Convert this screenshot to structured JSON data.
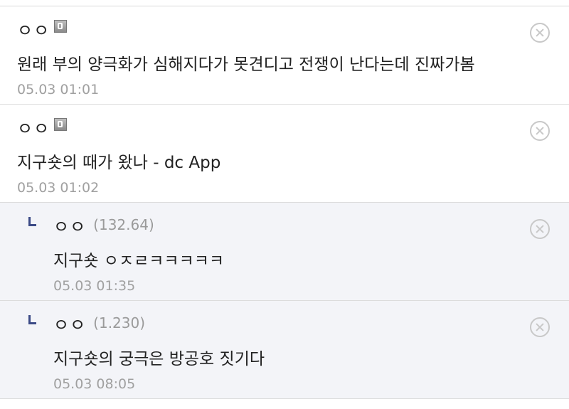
{
  "comments": [
    {
      "nick": "ㅇㅇ",
      "text": "원래 부의 양극화가 심해지다가 못견디고 전쟁이 난다는데 진짜가봄",
      "date": "05.03 01:01"
    },
    {
      "nick": "ㅇㅇ",
      "text": "지구숏의 때가 왔나 - dc App",
      "date": "05.03 01:02"
    }
  ],
  "replies": [
    {
      "nick": "ㅇㅇ",
      "ip": "(132.64)",
      "text": "지구숏 ㅇㅈㄹㅋㅋㅋㅋㅋ",
      "date": "05.03 01:35"
    },
    {
      "nick": "ㅇㅇ",
      "ip": "(1.230)",
      "text": "지구숏의 궁극은 방공호 짓기다",
      "date": "05.03 08:05"
    }
  ],
  "icons": {
    "gallog": "gallog-icon",
    "delete": "close-circle-icon",
    "reply": "reply-arrow-icon"
  },
  "colors": {
    "reply_background": "#f3f4f8",
    "reply_marker": "#3b4a86",
    "date_text": "#a0a0a0"
  }
}
